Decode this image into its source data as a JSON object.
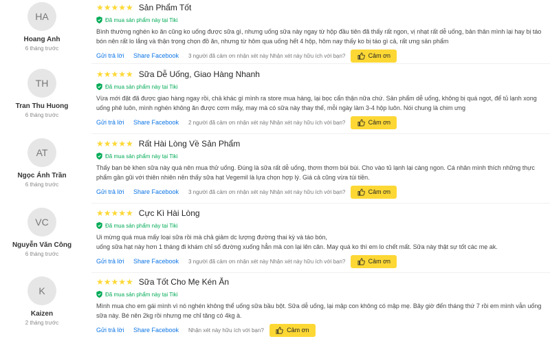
{
  "reviews": [
    {
      "initials": "HA",
      "name": "Hoang Anh",
      "time": "6 tháng trước",
      "stars": "★★★★★",
      "title": "Sản Phẩm Tốt",
      "verified": "Đã mua sản phẩm này tại Tiki",
      "body": "Bình thường nghén ko ăn cũng ko uống được sữa gì, nhưng uống sữa này ngay từ hộp đầu tiên đã thấy rất ngon, vị nhạt rất dễ uống, bản thân mình lại hay bị táo bón nên rất lo lắng và thận trọng chọn đồ ăn, nhưng từ hôm qua uống hết 4 hộp, hôm nay thấy ko bị táo gì cả, rất ưng sản phẩm",
      "reply": "Gửi trả lời",
      "share": "Share Facebook",
      "helpful": "3 người đã cảm ơn nhận xét này Nhận xét này hữu ích với bạn?",
      "thanks": "Cảm ơn"
    },
    {
      "initials": "TH",
      "name": "Tran Thu Huong",
      "time": "6 tháng trước",
      "stars": "★★★★★",
      "title": "Sữa Dễ Uống, Giao Hàng Nhanh",
      "verified": "Đã mua sản phẩm này tại Tiki",
      "body": "Vừa mới đặt đã được giao hàng ngay rồi, chả khác gì mình ra store mua hàng, lại bọc cẩn thận nữa chứ. Sản phẩm dễ uống, không bị quá ngọt, để tủ lạnh xong uống phê luôn, mình nghén không ăn được cơm mấy, may mà có sữa này thay thế, mỗi ngày làm 3-4 hộp luôn. Nói chung là chim ưng",
      "reply": "Gửi trả lời",
      "share": "Share Facebook",
      "helpful": "2 người đã cảm ơn nhận xét này Nhận xét này hữu ích với bạn?",
      "thanks": "Cảm ơn"
    },
    {
      "initials": "AT",
      "name": "Ngọc Ánh Trần",
      "time": "6 tháng trước",
      "stars": "★★★★★",
      "title": "Rất Hài Lòng Về Sản Phẩm",
      "verified": "Đã mua sản phẩm này tại Tiki",
      "body": "Thấy bạn bè khen sữa này quá nên mua thử uống. Đúng là sữa rất dễ uống, thơm thơm bùi bùi. Cho vào tủ lạnh lại càng ngon. Cá nhân mình thích những thực phẩm gần gũi với thiên nhiên nên thấy sữa hạt Vegemil là lựa chọn hợp lý. Giá cả cũng vừa túi tiền.",
      "reply": "Gửi trả lời",
      "share": "Share Facebook",
      "helpful": "3 người đã cảm ơn nhận xét này Nhận xét này hữu ích với bạn?",
      "thanks": "Cảm ơn"
    },
    {
      "initials": "VC",
      "name": "Nguyễn Văn Công",
      "time": "6 tháng trước",
      "stars": "★★★★★",
      "title": "Cực Kì Hài Lòng",
      "verified": "Đã mua sản phẩm này tại Tiki",
      "body": "Ui mừng quá mua mấy loại sữa rồi mà chả giảm dc lượng đường thai kỳ và táo bón,\nuống sữa hạt này hơn 1 tháng đi khám chỉ số đường xuống hẳn mà con lại lên cân. May quá ko thì em lo chết mất. Sữa này thật sự tốt các mẹ ak.",
      "reply": "Gửi trả lời",
      "share": "Share Facebook",
      "helpful": "3 người đã cảm ơn nhận xét này Nhận xét này hữu ích với bạn?",
      "thanks": "Cảm ơn"
    },
    {
      "initials": "K",
      "name": "Kaizen",
      "time": "2 tháng trước",
      "stars": "★★★★★",
      "title": "Sữa Tốt Cho Mẹ Kén Ăn",
      "verified": "Đã mua sản phẩm này tại Tiki",
      "body": "Mình mua cho em gái mình vì nó nghén không thể uống sữa bầu bột. Sữa dễ uống, lại mập con không có mập mẹ. Bây giờ đến tháng thứ 7 rồi em mình vẫn uống sữa này. Bé nên 2kg rồi nhưng mẹ chỉ tăng có 4kg à.",
      "reply": "Gửi trả lời",
      "share": "Share Facebook",
      "helpful": "Nhận xét này hữu ích với bạn?",
      "thanks": "Cảm ơn"
    }
  ],
  "colors": {
    "star": "#fdd835",
    "verified": "#00ab56",
    "link": "#0b74e5",
    "button": "#fdd835"
  },
  "icons": {
    "star": "star-icon",
    "verified": "shield-check-icon",
    "thanks": "thumbs-up-icon"
  }
}
